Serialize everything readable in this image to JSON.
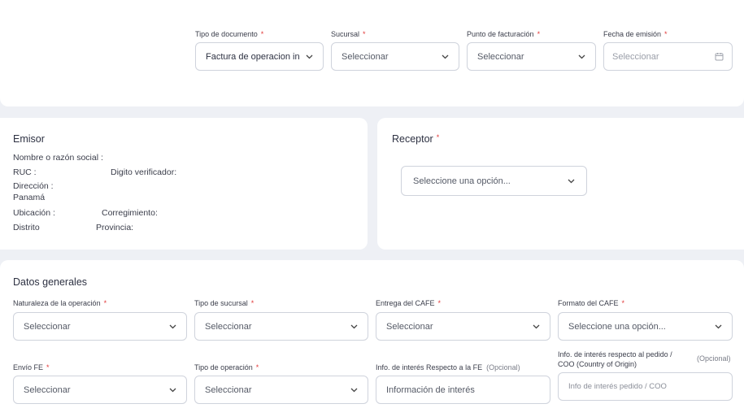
{
  "top": {
    "tipo_documento": {
      "label": "Tipo de documento",
      "value": "Factura de operacion in"
    },
    "sucursal": {
      "label": "Sucursal",
      "value": "Seleccionar"
    },
    "punto_facturacion": {
      "label": "Punto de facturación",
      "value": "Seleccionar"
    },
    "fecha_emision": {
      "label": "Fecha de emisión",
      "value": "Seleccionar"
    },
    "required_mark": "*"
  },
  "emisor": {
    "title": "Emisor",
    "nombre": "Nombre o razón social :",
    "ruc": "RUC :",
    "digito": "Digito verificador:",
    "direccion": "Dirección :",
    "pais": "Panamá",
    "ubicacion": "Ubicación :",
    "corregimiento": "Corregimiento:",
    "distrito": "Distrito",
    "provincia": "Provincia:"
  },
  "receptor": {
    "title": "Receptor",
    "value": "Seleccione una opción..."
  },
  "datos": {
    "title": "Datos generales",
    "naturaleza": {
      "label": "Naturaleza de la operación",
      "value": "Seleccionar"
    },
    "tipo_sucursal": {
      "label": "Tipo de sucursal",
      "value": "Seleccionar"
    },
    "entrega_cafe": {
      "label": "Entrega del CAFE",
      "value": "Seleccionar"
    },
    "formato_cafe": {
      "label": "Formato del CAFE",
      "value": "Seleccione una opción..."
    },
    "envio_fe": {
      "label": "Envío FE",
      "value": "Seleccionar"
    },
    "tipo_operacion": {
      "label": "Tipo de operación",
      "value": "Seleccionar"
    },
    "info_fe": {
      "label": "Info. de interés Respecto a la FE",
      "optional": "(Opcional)",
      "placeholder": "Información de interés"
    },
    "info_pedido": {
      "label_1": "Info. de interés respecto al pedido /",
      "label_2": "COO (Country of Origin)",
      "optional": "(Opcional)",
      "placeholder": "Info de interés pedido / COO"
    }
  }
}
